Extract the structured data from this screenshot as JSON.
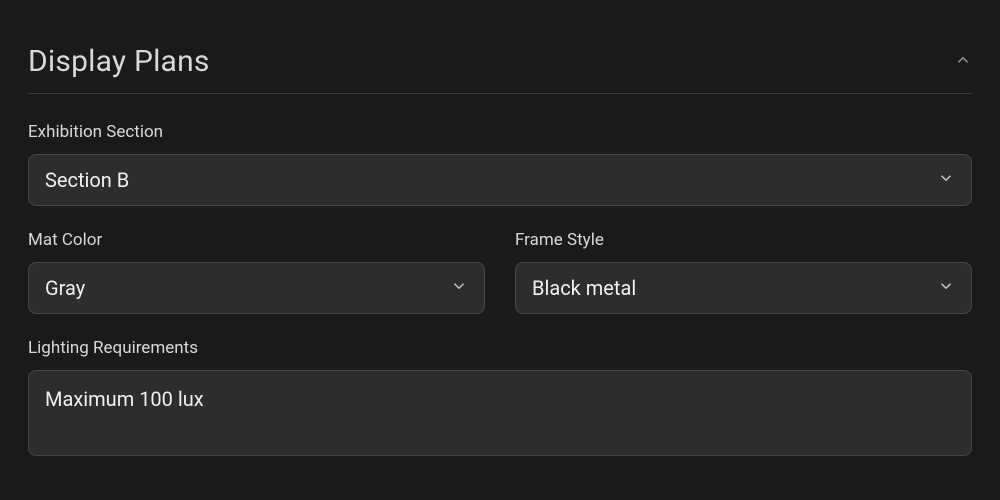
{
  "section": {
    "title": "Display Plans"
  },
  "fields": {
    "exhibition_section": {
      "label": "Exhibition Section",
      "value": "Section B"
    },
    "mat_color": {
      "label": "Mat Color",
      "value": "Gray"
    },
    "frame_style": {
      "label": "Frame Style",
      "value": "Black metal"
    },
    "lighting": {
      "label": "Lighting Requirements",
      "value": "Maximum 100 lux"
    }
  }
}
